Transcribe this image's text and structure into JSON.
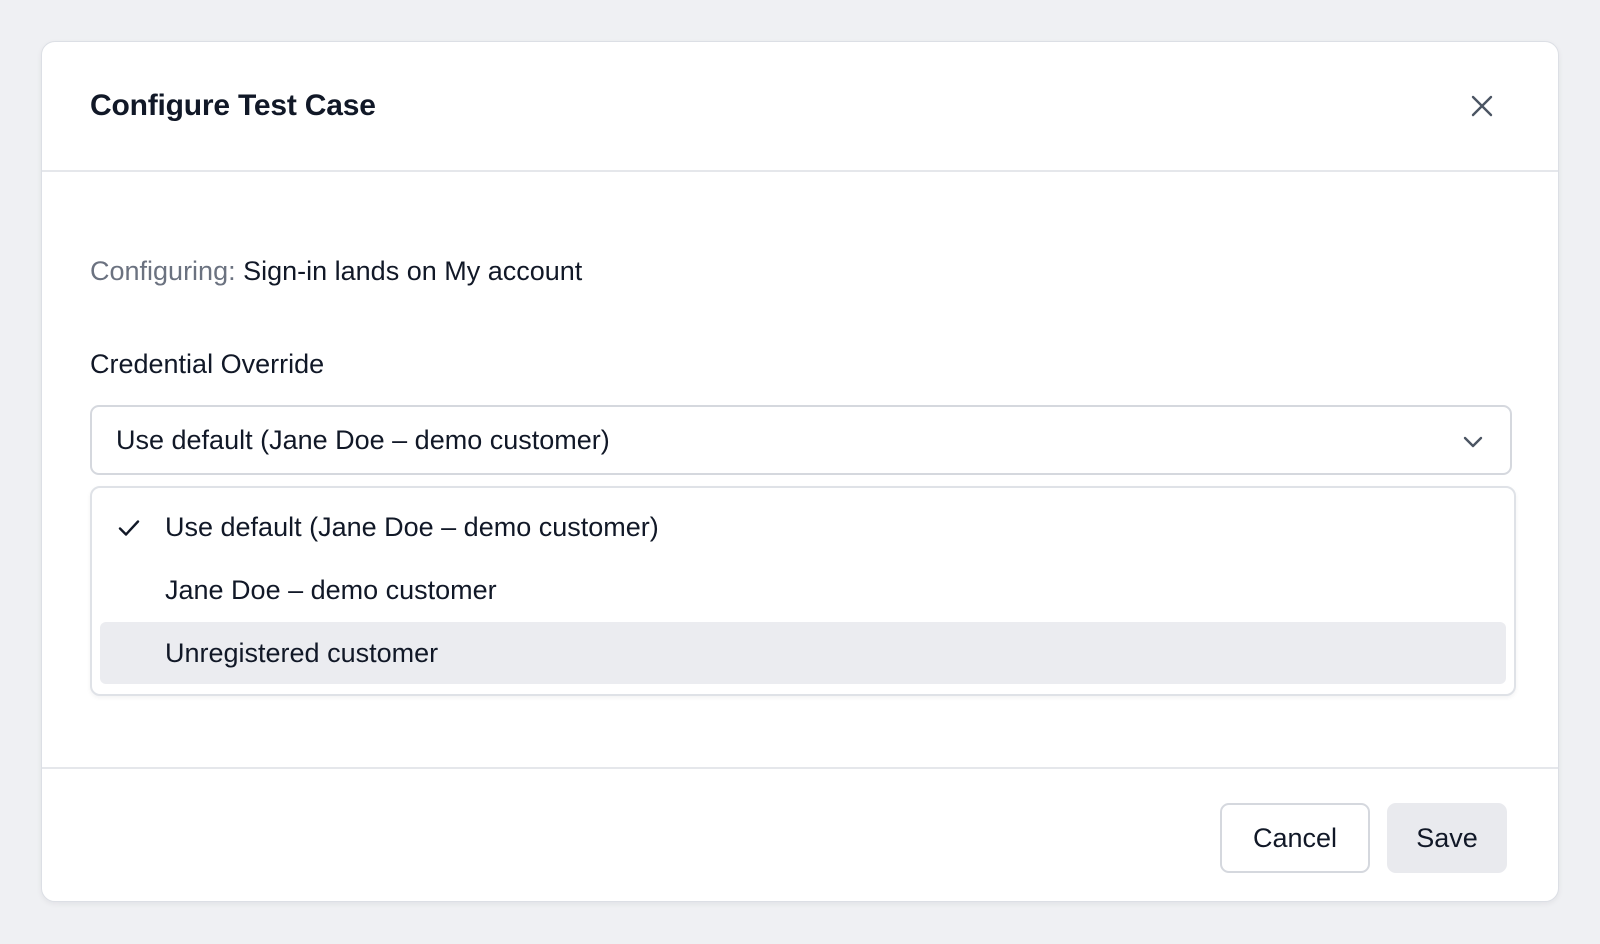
{
  "modal": {
    "title": "Configure Test Case",
    "close_icon": "close-icon"
  },
  "configuring": {
    "prefix": "Configuring:",
    "name": "Sign-in lands on My account"
  },
  "credential_override": {
    "label": "Credential Override",
    "selected_value": "Use default (Jane Doe – demo customer)",
    "chevron_icon": "chevron-down-icon",
    "options": [
      {
        "label": "Use default (Jane Doe – demo customer)",
        "selected": true,
        "highlighted": false
      },
      {
        "label": "Jane Doe – demo customer",
        "selected": false,
        "highlighted": false
      },
      {
        "label": "Unregistered customer",
        "selected": false,
        "highlighted": true
      }
    ]
  },
  "footer": {
    "cancel_label": "Cancel",
    "save_label": "Save"
  },
  "colors": {
    "background": "#eff0f3",
    "text_primary": "#111827",
    "text_muted": "#6b7280",
    "highlight": "#ebecf0",
    "save_button_bg": "#e9eaee"
  }
}
